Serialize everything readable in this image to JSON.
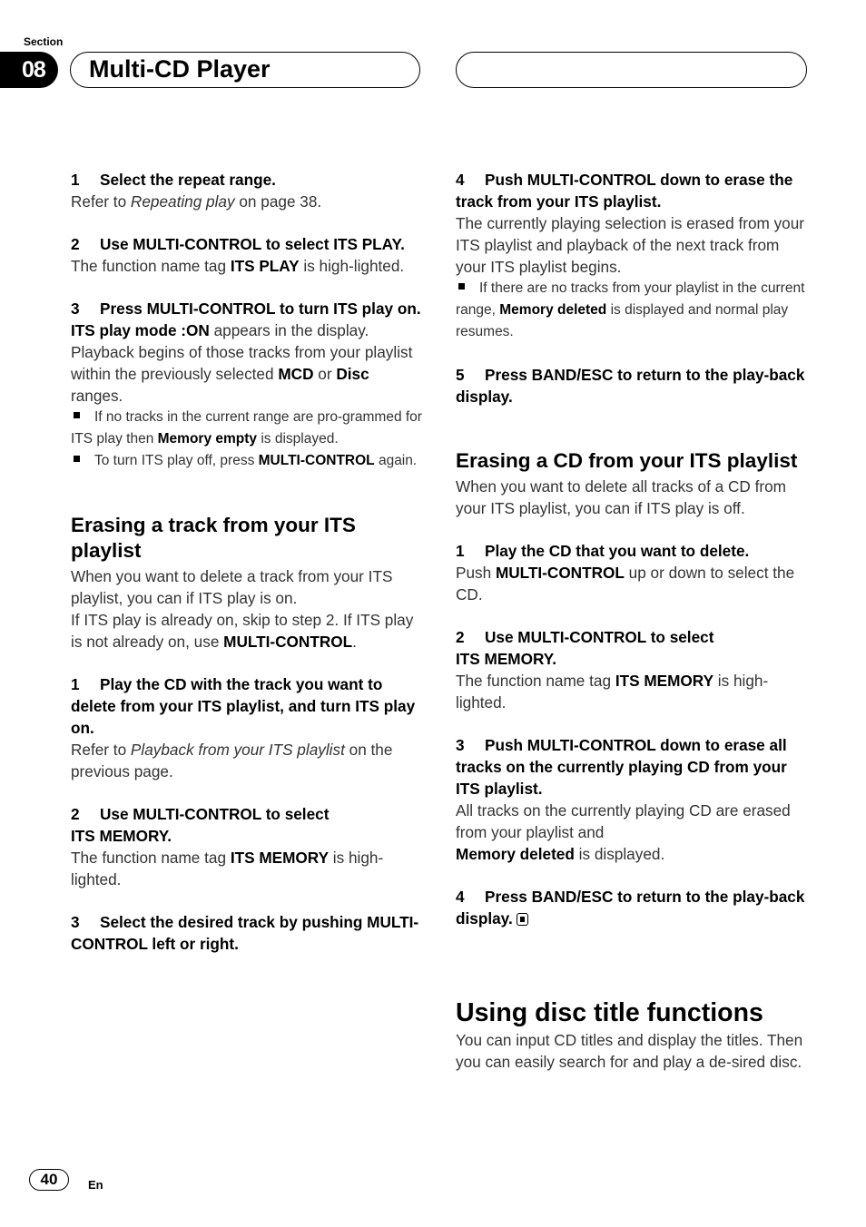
{
  "header": {
    "section_label": "Section",
    "section_number": "08",
    "title": "Multi-CD Player"
  },
  "left_column": {
    "step1": {
      "num": "1",
      "title": "Select the repeat range.",
      "body_pre": "Refer to ",
      "body_italic": "Repeating play",
      "body_post": " on page 38."
    },
    "step2": {
      "num": "2",
      "title": "Use MULTI-CONTROL to select ITS PLAY.",
      "body_pre": "The function name tag ",
      "body_bold": "ITS PLAY",
      "body_post": " is high-lighted."
    },
    "step3": {
      "num": "3",
      "title": "Press MULTI-CONTROL to turn ITS play on.",
      "line1_bold": "ITS play mode :ON",
      "line1_post": " appears in the display.",
      "line2_pre": "Playback begins of those tracks from your playlist within the previously selected ",
      "line2_bold1": "MCD",
      "line2_mid": " or ",
      "line2_bold2": "Disc",
      "line2_post": " ranges.",
      "note1_pre": "If no tracks in the current range are pro-grammed for ITS play then ",
      "note1_bold": "Memory empty",
      "note1_post": " is displayed.",
      "note2_pre": "To turn ITS play off, press ",
      "note2_bold": "MULTI-CONTROL",
      "note2_post": " again."
    },
    "erase_track": {
      "heading": "Erasing a track from your ITS playlist",
      "intro1": "When you want to delete a track from your ITS playlist, you can if ITS play is on.",
      "intro2_pre": "If ITS play is already on, skip to step 2. If ITS play is not already on, use ",
      "intro2_bold": "MULTI-CONTROL",
      "intro2_post": ".",
      "step1": {
        "num": "1",
        "title": "Play the CD with the track you want to delete from your ITS playlist, and turn ITS play on.",
        "body_pre": "Refer to ",
        "body_italic": "Playback from your ITS playlist",
        "body_post": " on the previous page."
      },
      "step2": {
        "num": "2",
        "title_line1": "Use MULTI-CONTROL to select",
        "title_line2": "ITS MEMORY.",
        "body_pre": "The function name tag ",
        "body_bold": "ITS MEMORY",
        "body_post": " is high-lighted."
      },
      "step3": {
        "num": "3",
        "title": "Select the desired track by pushing MULTI-CONTROL left or right."
      }
    }
  },
  "right_column": {
    "step4": {
      "num": "4",
      "title": "Push MULTI-CONTROL down to erase the track from your ITS playlist.",
      "body": "The currently playing selection is erased from your ITS playlist and playback of the next track from your ITS playlist begins.",
      "note_pre": "If there are no tracks from your playlist in the current range, ",
      "note_bold": "Memory deleted",
      "note_post": " is displayed and normal play resumes."
    },
    "step5": {
      "num": "5",
      "title": "Press BAND/ESC to return to the play-back display."
    },
    "erase_cd": {
      "heading": "Erasing a CD from your ITS playlist",
      "intro": "When you want to delete all tracks of a CD from your ITS playlist, you can if ITS play is off.",
      "step1": {
        "num": "1",
        "title": "Play the CD that you want to delete.",
        "body_pre": "Push ",
        "body_bold": "MULTI-CONTROL",
        "body_post": " up or down to select the CD."
      },
      "step2": {
        "num": "2",
        "title_line1": "Use MULTI-CONTROL to select",
        "title_line2": "ITS MEMORY.",
        "body_pre": "The function name tag ",
        "body_bold": "ITS MEMORY",
        "body_post": " is high-lighted."
      },
      "step3": {
        "num": "3",
        "title": "Push MULTI-CONTROL down to erase all tracks on the currently playing CD from your ITS playlist.",
        "body_line1": "All tracks on the currently playing CD are erased from your playlist and",
        "body_bold": "Memory deleted",
        "body_post": " is displayed."
      },
      "step4": {
        "num": "4",
        "title": "Press BAND/ESC to return to the play-back display.",
        "end_icon": "end-of-section-icon"
      }
    },
    "disc_title": {
      "heading": "Using disc title functions",
      "body": "You can input CD titles and display the titles. Then you can easily search for and play a de-sired disc."
    }
  },
  "footer": {
    "page_number": "40",
    "language": "En"
  }
}
